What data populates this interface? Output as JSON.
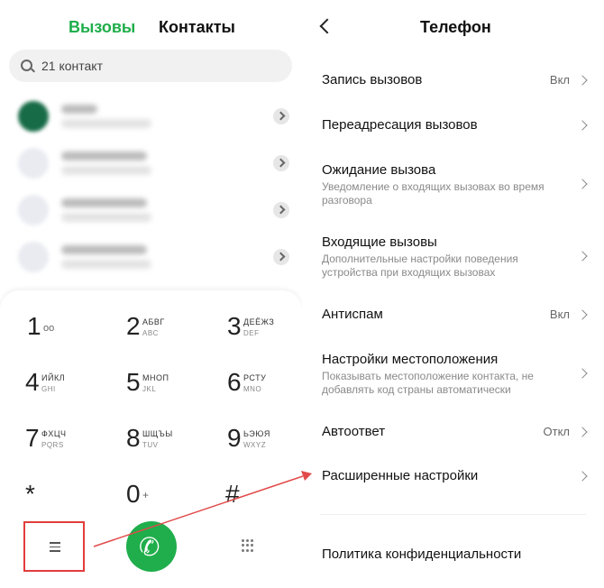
{
  "left_panel": {
    "tabs": {
      "calls": "Вызовы",
      "contacts": "Контакты"
    },
    "search": {
      "placeholder": "21 контакт"
    },
    "dialpad": {
      "keys": [
        {
          "digit": "1",
          "letters_primary": "",
          "letters_secondary": "",
          "voicemail": "oo"
        },
        {
          "digit": "2",
          "letters_primary": "АБВГ",
          "letters_secondary": "ABC"
        },
        {
          "digit": "3",
          "letters_primary": "ДЕЁЖЗ",
          "letters_secondary": "DEF"
        },
        {
          "digit": "4",
          "letters_primary": "ИЙКЛ",
          "letters_secondary": "GHI"
        },
        {
          "digit": "5",
          "letters_primary": "МНОП",
          "letters_secondary": "JKL"
        },
        {
          "digit": "6",
          "letters_primary": "РСТУ",
          "letters_secondary": "MNO"
        },
        {
          "digit": "7",
          "letters_primary": "ФХЦЧ",
          "letters_secondary": "PQRS"
        },
        {
          "digit": "8",
          "letters_primary": "ШЩЪЫ",
          "letters_secondary": "TUV"
        },
        {
          "digit": "9",
          "letters_primary": "ЬЭЮЯ",
          "letters_secondary": "WXYZ"
        },
        {
          "digit": "*",
          "letters_primary": "",
          "letters_secondary": ""
        },
        {
          "digit": "0",
          "letters_primary": "+",
          "letters_secondary": ""
        },
        {
          "digit": "#",
          "letters_primary": "",
          "letters_secondary": ""
        }
      ]
    },
    "bottom_bar": {
      "menu_icon": "menu-icon",
      "call_icon": "phone-icon",
      "keypad_icon": "keypad-icon"
    },
    "colors": {
      "accent": "#1fae4b",
      "highlight": "#e23c3c"
    }
  },
  "right_panel": {
    "header": {
      "title": "Телефон"
    },
    "settings": [
      {
        "title": "Запись вызовов",
        "value": "Вкл"
      },
      {
        "title": "Переадресация вызовов"
      },
      {
        "title": "Ожидание вызова",
        "description": "Уведомление о входящих вызовах во время разговора"
      },
      {
        "title": "Входящие вызовы",
        "description": "Дополнительные настройки поведения устройства при входящих вызовах"
      },
      {
        "title": "Антиспам",
        "value": "Вкл"
      },
      {
        "title": "Настройки местоположения",
        "description": "Показывать местоположение контакта, не добавлять код страны автоматически"
      },
      {
        "title": "Автоответ",
        "value": "Откл"
      },
      {
        "title": "Расширенные настройки"
      },
      {
        "title": "Политика конфиденциальности"
      }
    ]
  }
}
